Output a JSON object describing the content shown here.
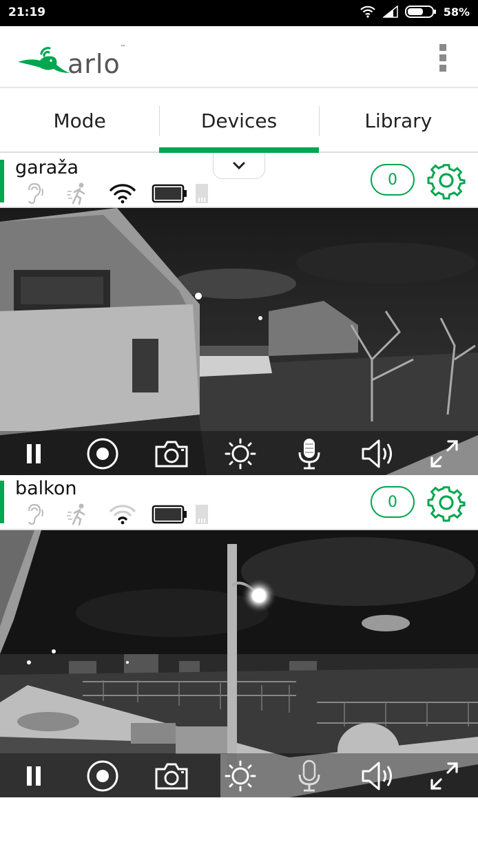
{
  "status": {
    "time": "21:19",
    "battery": "58%"
  },
  "app": {
    "brand": "arlo",
    "brand_tm": "™",
    "accent_color": "#00a650"
  },
  "tabs": [
    {
      "label": "Mode",
      "active": false
    },
    {
      "label": "Devices",
      "active": true
    },
    {
      "label": "Library",
      "active": false
    }
  ],
  "devices": [
    {
      "name": "garaža",
      "count": "0",
      "icons": [
        "hearing-icon",
        "motion-icon",
        "wifi-icon",
        "battery-icon",
        "sd-card-icon"
      ],
      "wifi_active": true,
      "controls": [
        "pause-icon",
        "record-icon",
        "snapshot-icon",
        "brightness-icon",
        "microphone-icon",
        "speaker-icon",
        "fullscreen-icon"
      ]
    },
    {
      "name": "balkon",
      "count": "0",
      "icons": [
        "hearing-icon",
        "motion-icon",
        "wifi-icon",
        "battery-icon",
        "sd-card-icon"
      ],
      "wifi_active": false,
      "controls": [
        "pause-icon",
        "record-icon",
        "snapshot-icon",
        "brightness-icon",
        "microphone-icon",
        "speaker-icon",
        "fullscreen-icon"
      ]
    }
  ]
}
